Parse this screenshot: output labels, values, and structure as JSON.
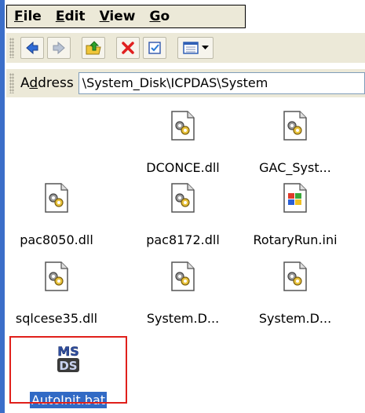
{
  "menu": [
    {
      "label": "File",
      "mnemonic": "F",
      "rest": "ile"
    },
    {
      "label": "Edit",
      "mnemonic": "E",
      "rest": "dit"
    },
    {
      "label": "View",
      "mnemonic": "V",
      "rest": "iew"
    },
    {
      "label": "Go",
      "mnemonic": "G",
      "rest": "o"
    }
  ],
  "toolbar": {
    "buttons": [
      "back-icon",
      "forward-icon",
      "up-folder-icon",
      "delete-icon",
      "properties-icon",
      "views-icon"
    ]
  },
  "address": {
    "label_mnemonic_pre": "A",
    "label_mnemonic": "d",
    "label_rest": "dress",
    "value": "\\System_Disk\\ICPDAS\\System"
  },
  "files": [
    {
      "name": "DCONCE.dll",
      "type": "dll"
    },
    {
      "name": "GAC_Syst...",
      "type": "dll"
    },
    {
      "name": "pac8050.dll",
      "type": "dll"
    },
    {
      "name": "pac8172.dll",
      "type": "dll"
    },
    {
      "name": "RotaryRun.ini",
      "type": "ini"
    },
    {
      "name": "sqlcese35.dll",
      "type": "dll"
    },
    {
      "name": "System.D...",
      "type": "dll"
    },
    {
      "name": "System.D...",
      "type": "dll"
    },
    {
      "name": "AutoInit.bat",
      "type": "bat",
      "selected": true
    }
  ],
  "colors": {
    "selection": "#316ac5",
    "highlight_frame": "#e0201b",
    "chrome": "#ece9d8",
    "left_rail": "#3b6ec9"
  }
}
